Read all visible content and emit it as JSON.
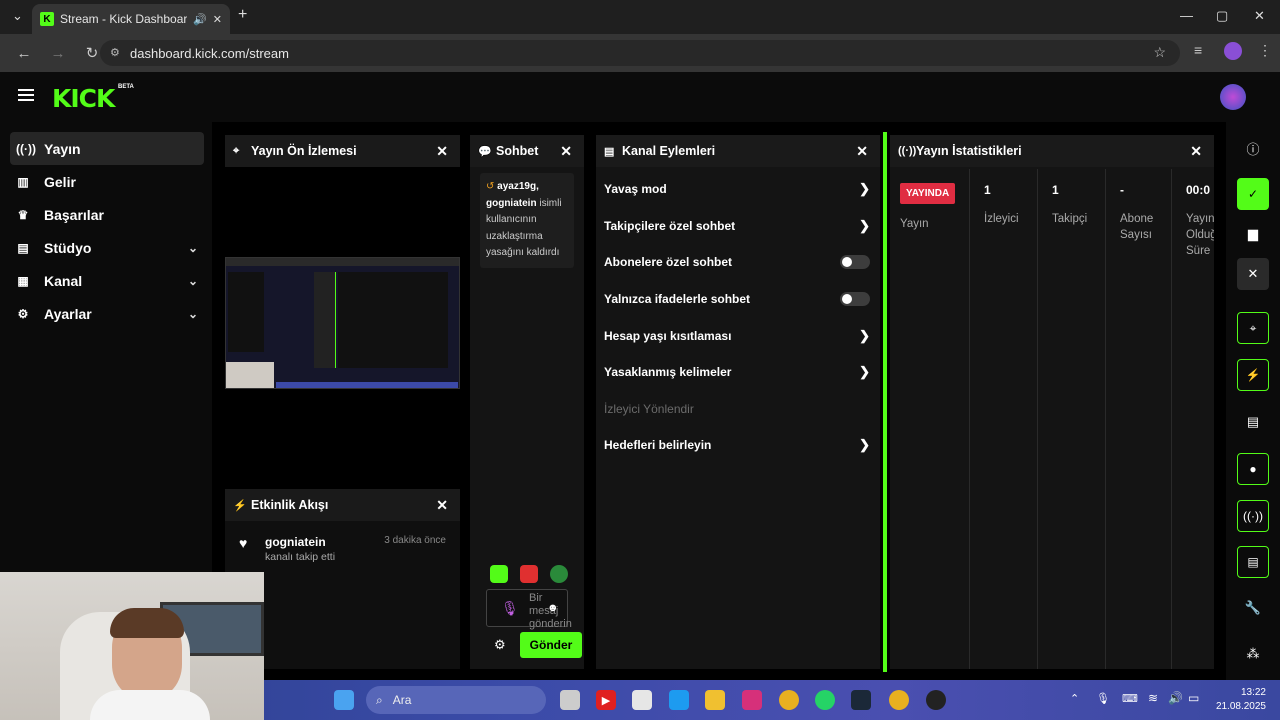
{
  "browser": {
    "tab_title": "Stream - Kick Dashboard",
    "url": "dashboard.kick.com/stream"
  },
  "app": {
    "logo": "KICK",
    "beta": "BETA"
  },
  "sidebar": {
    "items": [
      {
        "label": "Yayın",
        "icon": "broadcast-icon"
      },
      {
        "label": "Gelir",
        "icon": "chart-icon"
      },
      {
        "label": "Başarılar",
        "icon": "trophy-icon"
      },
      {
        "label": "Stüdyo",
        "icon": "studio-icon"
      },
      {
        "label": "Kanal",
        "icon": "channel-icon"
      },
      {
        "label": "Ayarlar",
        "icon": "gear-icon"
      }
    ]
  },
  "preview": {
    "title": "Yayın Ön İzlemesi"
  },
  "activity": {
    "title": "Etkinlik Akışı",
    "user": "gogniatein",
    "action": "kanalı takip etti",
    "time": "3 dakika önce"
  },
  "chat": {
    "title": "Sohbet",
    "message_user1": "ayaz19g,",
    "message_user2": "gogniatein",
    "message_text": "isimli kullanıcının uzaklaştırma yasağını kaldırdı",
    "input_placeholder": "Bir mesaj gönderin",
    "send_label": "Gönder"
  },
  "channel_actions": {
    "title": "Kanal Eylemleri",
    "items": [
      {
        "label": "Yavaş mod",
        "kind": "arrow"
      },
      {
        "label": "Takipçilere özel sohbet",
        "kind": "arrow"
      },
      {
        "label": "Abonelere özel sohbet",
        "kind": "toggle",
        "on": false
      },
      {
        "label": "Yalnızca ifadelerle sohbet",
        "kind": "toggle",
        "on": false
      },
      {
        "label": "Hesap yaşı kısıtlaması",
        "kind": "arrow"
      },
      {
        "label": "Yasaklanmış kelimeler",
        "kind": "arrow"
      },
      {
        "label": "İzleyici Yönlendir",
        "kind": "disabled"
      },
      {
        "label": "Hedefleri belirleyin",
        "kind": "arrow"
      }
    ]
  },
  "stats": {
    "title": "Yayın İstatistikleri",
    "live_badge": "YAYINDA",
    "cols": [
      {
        "value": "",
        "label": "Yayın"
      },
      {
        "value": "1",
        "label": "İzleyici"
      },
      {
        "value": "1",
        "label": "Takipçi"
      },
      {
        "value": "-",
        "label": "Abone Sayısı"
      },
      {
        "value": "00:0",
        "label": "Yayın Olduğ Süre"
      }
    ]
  },
  "taskbar": {
    "search": "Ara",
    "time": "13:22",
    "date": "21.08.2025"
  },
  "colors": {
    "accent": "#53fc18",
    "live": "#e02d42"
  }
}
